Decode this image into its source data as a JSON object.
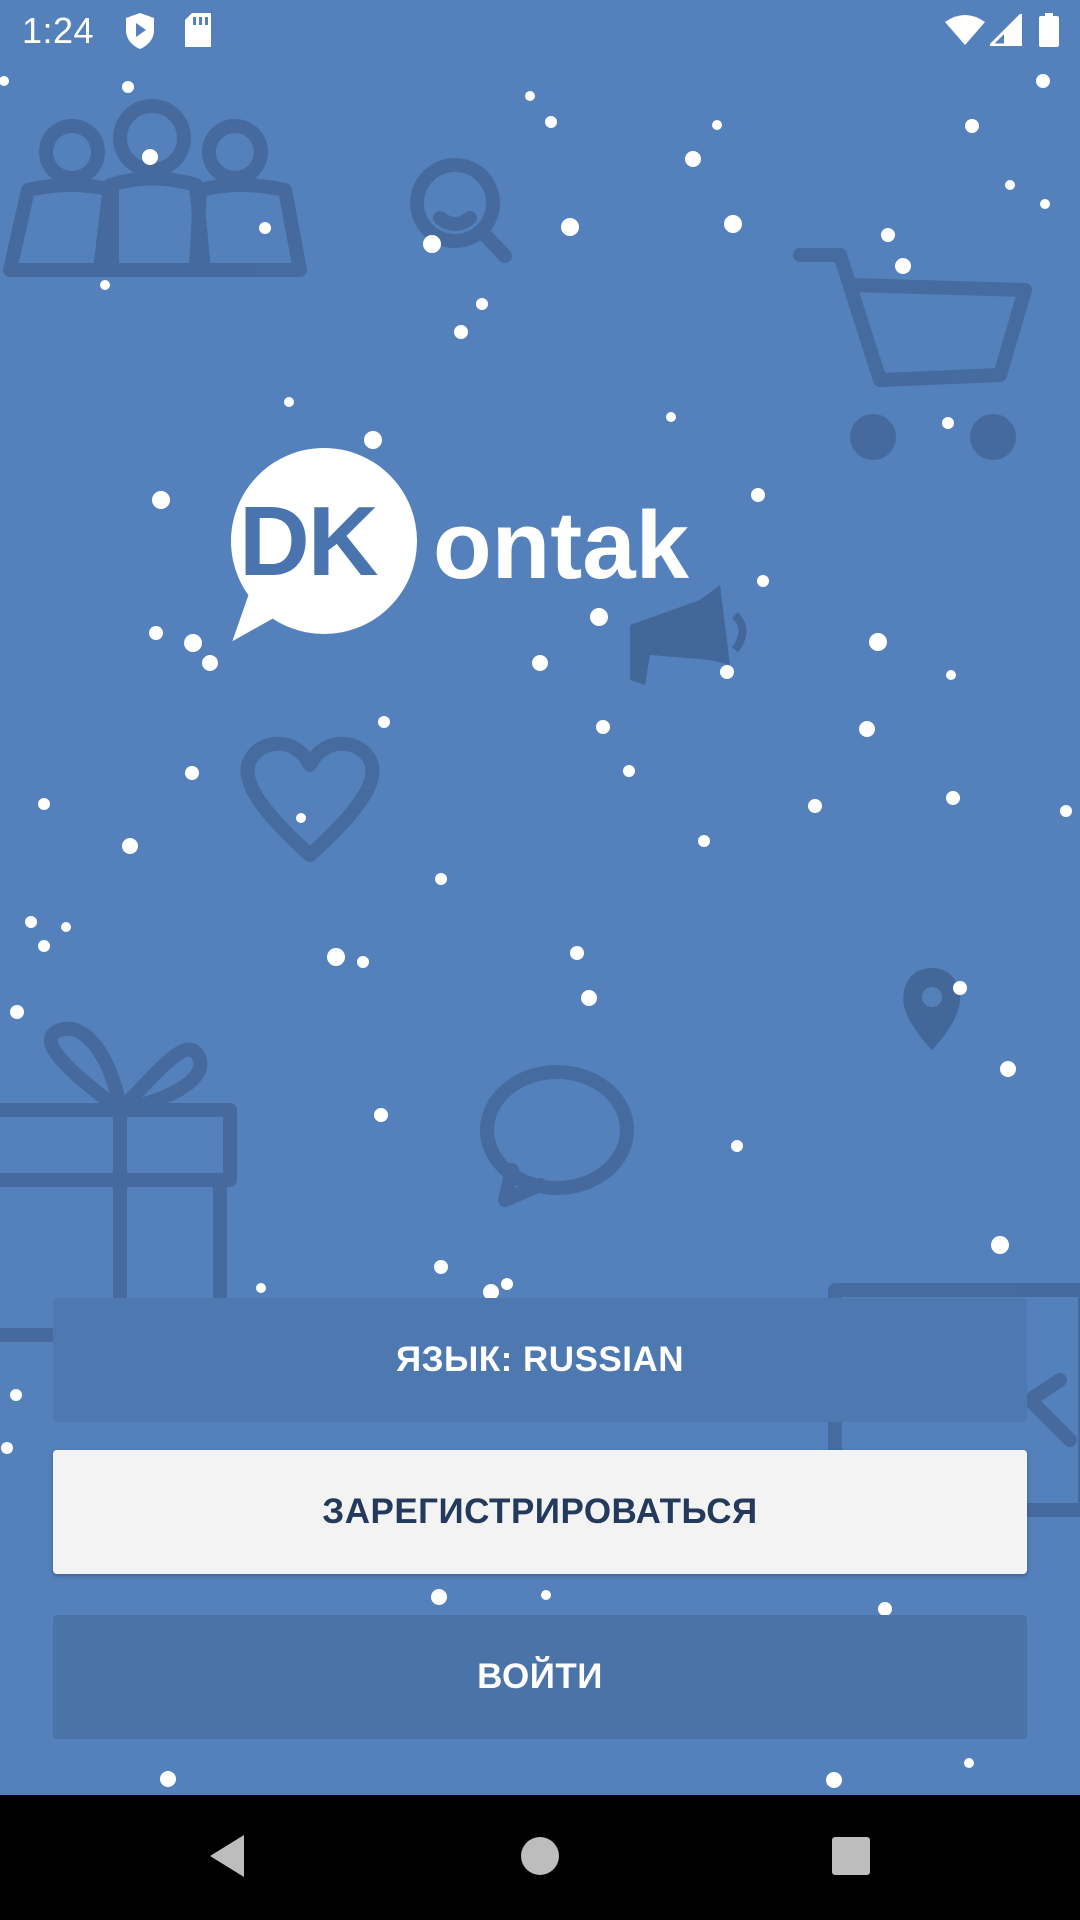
{
  "status_bar": {
    "time": "1:24",
    "icons": [
      "shield-play-icon",
      "sd-card-icon",
      "wifi-icon",
      "signal-icon",
      "battery-icon"
    ]
  },
  "logo": {
    "part1": "DK",
    "part2": "ontak"
  },
  "buttons": {
    "language": "ЯЗЫК: RUSSIAN",
    "register": "ЗАРЕГИСТРИРОВАТЬСЯ",
    "login": "ВОЙТИ"
  },
  "nav_bar": {
    "icons": [
      "back-icon",
      "home-icon",
      "recents-icon"
    ]
  },
  "colors": {
    "background": "#5481bb",
    "doodle": "#3e5f8e",
    "register_button": "#f3f3f3",
    "register_text": "#233a5c"
  }
}
